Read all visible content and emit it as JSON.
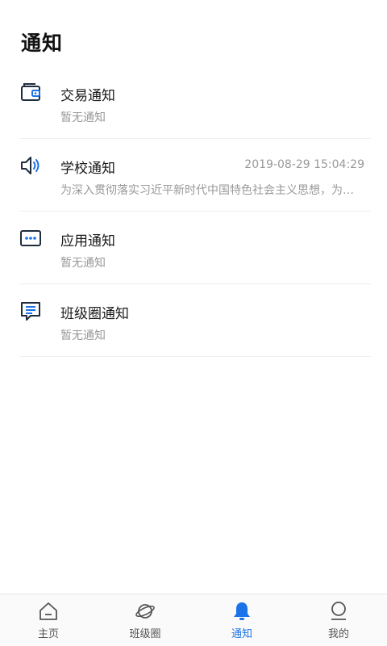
{
  "header": {
    "title": "通知"
  },
  "notifications": [
    {
      "title": "交易通知",
      "sub": "暂无通知",
      "time": "",
      "icon": "wallet-icon"
    },
    {
      "title": "学校通知",
      "sub": "为深入贯彻落实习近平新时代中国特色社会主义思想，为深入贯彻落实",
      "time": "2019-08-29 15:04:29",
      "icon": "speaker-icon"
    },
    {
      "title": "应用通知",
      "sub": "暂无通知",
      "time": "",
      "icon": "chat-dots-icon"
    },
    {
      "title": "班级圈通知",
      "sub": "暂无通知",
      "time": "",
      "icon": "message-lines-icon"
    }
  ],
  "tabs": [
    {
      "label": "主页",
      "icon": "home-icon",
      "active": false
    },
    {
      "label": "班级圈",
      "icon": "planet-icon",
      "active": false
    },
    {
      "label": "通知",
      "icon": "bell-icon",
      "active": true
    },
    {
      "label": "我的",
      "icon": "profile-icon",
      "active": false
    }
  ],
  "colors": {
    "accent": "#1a73e8",
    "icon_dark": "#1f2d3d",
    "muted": "#999999"
  }
}
